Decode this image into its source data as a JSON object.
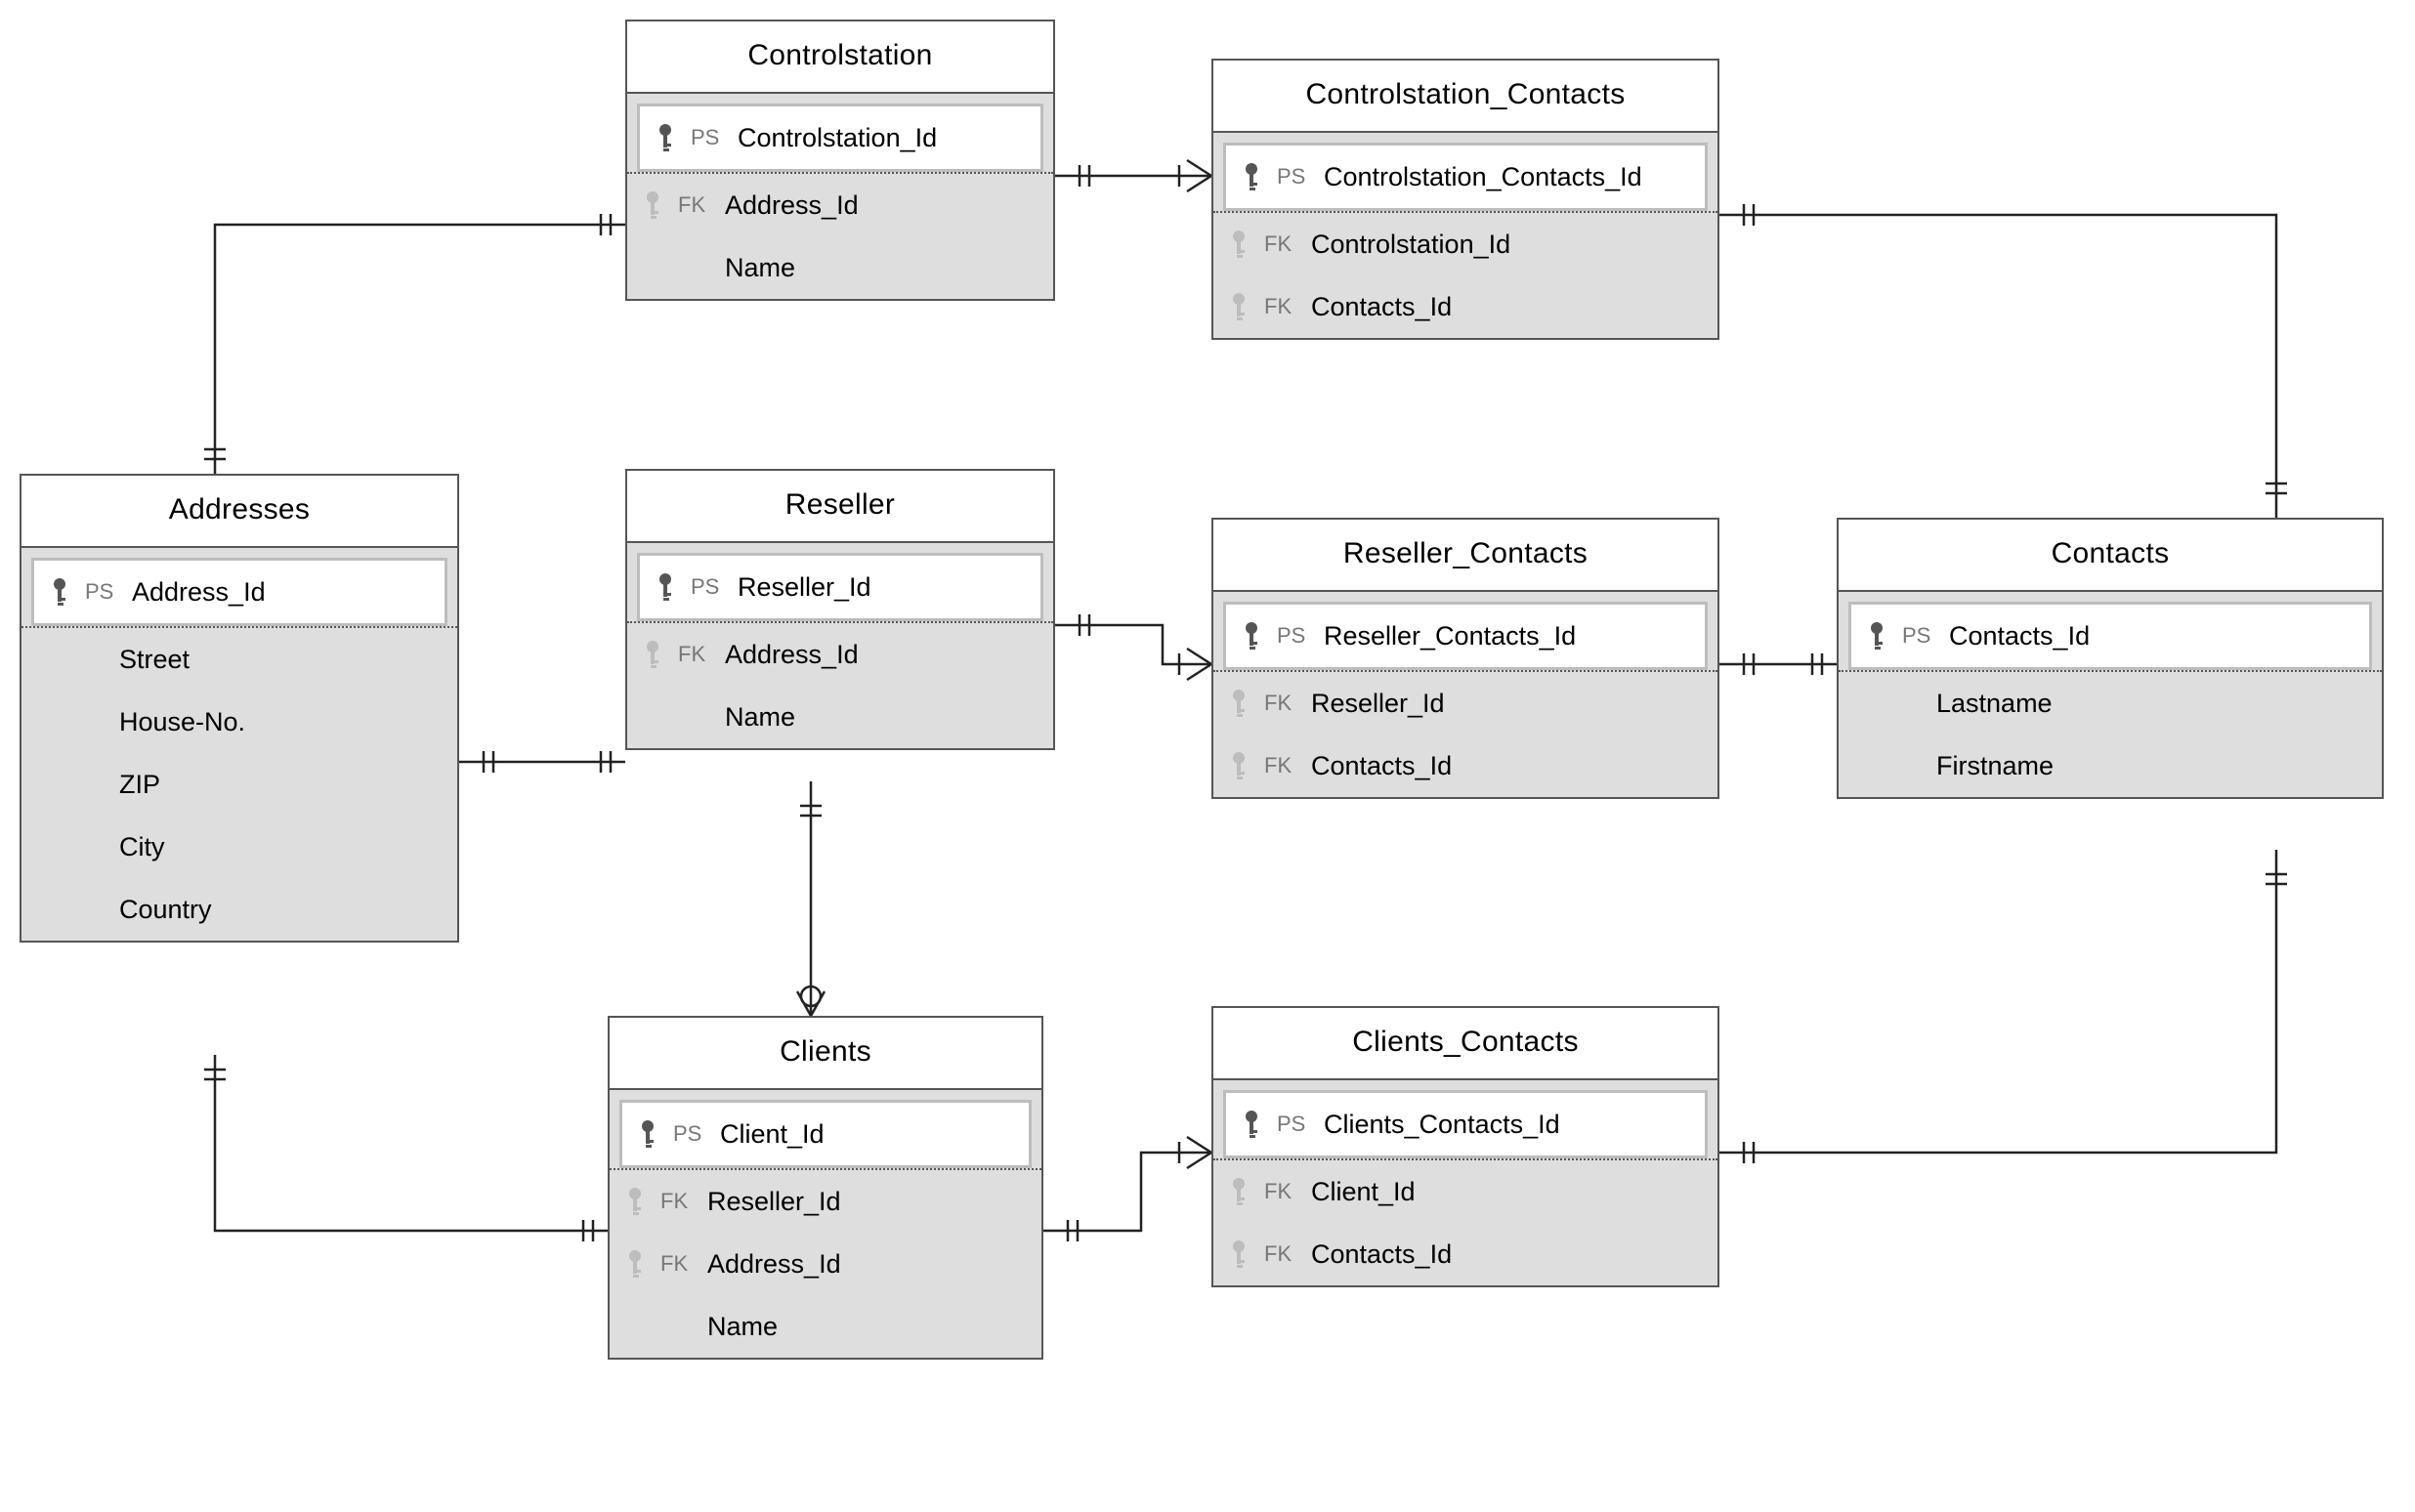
{
  "labels": {
    "ps": "PS",
    "fk": "FK"
  },
  "entities": {
    "controlstation": {
      "title": "Controlstation",
      "pk": "Controlstation_Id",
      "cols": [
        {
          "type": "fk",
          "name": "Address_Id"
        },
        {
          "type": "none",
          "name": "Name"
        }
      ]
    },
    "controlstation_contacts": {
      "title": "Controlstation_Contacts",
      "pk": "Controlstation_Contacts_Id",
      "cols": [
        {
          "type": "fk",
          "name": "Controlstation_Id"
        },
        {
          "type": "fk",
          "name": "Contacts_Id"
        }
      ]
    },
    "addresses": {
      "title": "Addresses",
      "pk": "Address_Id",
      "cols": [
        {
          "type": "none",
          "name": "Street"
        },
        {
          "type": "none",
          "name": "House-No."
        },
        {
          "type": "none",
          "name": "ZIP"
        },
        {
          "type": "none",
          "name": "City"
        },
        {
          "type": "none",
          "name": "Country"
        }
      ]
    },
    "reseller": {
      "title": "Reseller",
      "pk": "Reseller_Id",
      "cols": [
        {
          "type": "fk",
          "name": "Address_Id"
        },
        {
          "type": "none",
          "name": "Name"
        }
      ]
    },
    "reseller_contacts": {
      "title": "Reseller_Contacts",
      "pk": "Reseller_Contacts_Id",
      "cols": [
        {
          "type": "fk",
          "name": "Reseller_Id"
        },
        {
          "type": "fk",
          "name": "Contacts_Id"
        }
      ]
    },
    "contacts": {
      "title": "Contacts",
      "pk": "Contacts_Id",
      "cols": [
        {
          "type": "none",
          "name": "Lastname"
        },
        {
          "type": "none",
          "name": "Firstname"
        }
      ]
    },
    "clients": {
      "title": "Clients",
      "pk": "Client_Id",
      "cols": [
        {
          "type": "fk",
          "name": "Reseller_Id"
        },
        {
          "type": "fk",
          "name": "Address_Id"
        },
        {
          "type": "none",
          "name": "Name"
        }
      ]
    },
    "clients_contacts": {
      "title": "Clients_Contacts",
      "pk": "Clients_Contacts_Id",
      "cols": [
        {
          "type": "fk",
          "name": "Client_Id"
        },
        {
          "type": "fk",
          "name": "Contacts_Id"
        }
      ]
    }
  },
  "relationships": [
    {
      "from": "addresses",
      "to": "controlstation",
      "card_from": "one",
      "card_to": "one"
    },
    {
      "from": "addresses",
      "to": "reseller",
      "card_from": "one",
      "card_to": "one"
    },
    {
      "from": "addresses",
      "to": "clients",
      "card_from": "one",
      "card_to": "one"
    },
    {
      "from": "controlstation",
      "to": "controlstation_contacts",
      "card_from": "one",
      "card_to": "many"
    },
    {
      "from": "reseller",
      "to": "reseller_contacts",
      "card_from": "one",
      "card_to": "many"
    },
    {
      "from": "reseller",
      "to": "clients",
      "card_from": "one",
      "card_to": "zero-or-many"
    },
    {
      "from": "clients",
      "to": "clients_contacts",
      "card_from": "one",
      "card_to": "many"
    },
    {
      "from": "contacts",
      "to": "controlstation_contacts",
      "card_from": "one",
      "card_to": "one"
    },
    {
      "from": "contacts",
      "to": "reseller_contacts",
      "card_from": "one",
      "card_to": "one"
    },
    {
      "from": "contacts",
      "to": "clients_contacts",
      "card_from": "one",
      "card_to": "one"
    }
  ]
}
